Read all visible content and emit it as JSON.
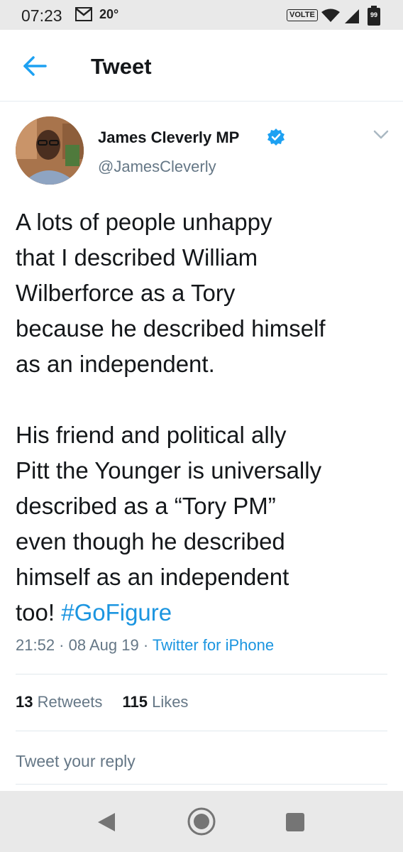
{
  "status_bar": {
    "time": "07:23",
    "temperature": "20°",
    "volte": "VOLTE",
    "battery": "99"
  },
  "header": {
    "title": "Tweet"
  },
  "author": {
    "name": "James Cleverly MP",
    "handle": "@JamesCleverly",
    "verified": true
  },
  "tweet": {
    "line1": "A lots of people unhappy",
    "line2": "that I described William",
    "line3": "Wilberforce as a Tory",
    "line4": "because he described himself",
    "line5": "as an independent.",
    "line6": "His friend and political ally",
    "line7": "Pitt the Younger is universally",
    "line8": "described as a “Tory PM”",
    "line9": "even though he described",
    "line10": "himself as an independent",
    "line11_text": "too! ",
    "hashtag": "#GoFigure"
  },
  "meta": {
    "time": "21:52",
    "sep1": " · ",
    "date": "08 Aug 19",
    "sep2": " · ",
    "source": "Twitter for iPhone"
  },
  "stats": {
    "retweets_count": "13",
    "retweets_label": "Retweets",
    "likes_count": "115",
    "likes_label": "Likes"
  },
  "reply": {
    "placeholder": "Tweet your reply"
  },
  "colors": {
    "accent": "#1b95e0",
    "secondary_text": "#657786",
    "system_bar": "#e9e9e9"
  },
  "icons": {
    "back": "arrow-left-icon",
    "verified": "verified-badge-icon",
    "more": "chevron-down-icon",
    "nav_back": "triangle-back-icon",
    "nav_home": "circle-home-icon",
    "nav_recent": "square-recent-icon"
  }
}
